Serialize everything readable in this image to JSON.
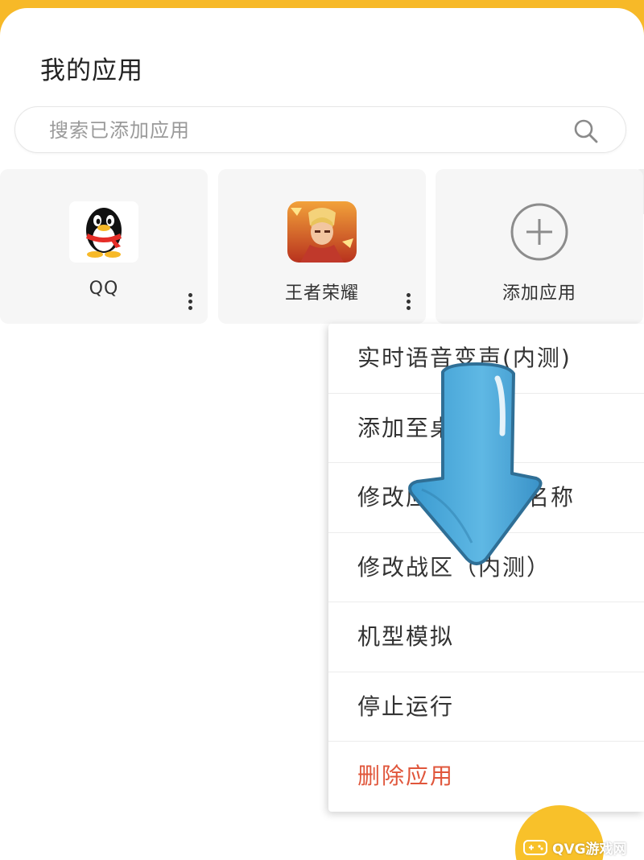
{
  "header": {
    "title": "我的应用"
  },
  "search": {
    "placeholder": "搜索已添加应用"
  },
  "apps": [
    {
      "label": "QQ",
      "icon": "qq-penguin-icon"
    },
    {
      "label": "王者荣耀",
      "icon": "honor-of-kings-icon"
    },
    {
      "label": "添加应用",
      "icon": "add-circle-icon"
    }
  ],
  "menu": {
    "items": [
      {
        "label": "实时语音变声(内测)"
      },
      {
        "label": "添加至桌面"
      },
      {
        "label": "修改应用图标及名称"
      },
      {
        "label": "修改战区（内测）"
      },
      {
        "label": "机型模拟"
      },
      {
        "label": "停止运行"
      },
      {
        "label": "删除应用"
      }
    ]
  },
  "watermark": {
    "text": "QVG游戏网"
  },
  "colors": {
    "accent": "#f7b928",
    "danger": "#e0563b",
    "arrow": "#4aa8d8"
  }
}
